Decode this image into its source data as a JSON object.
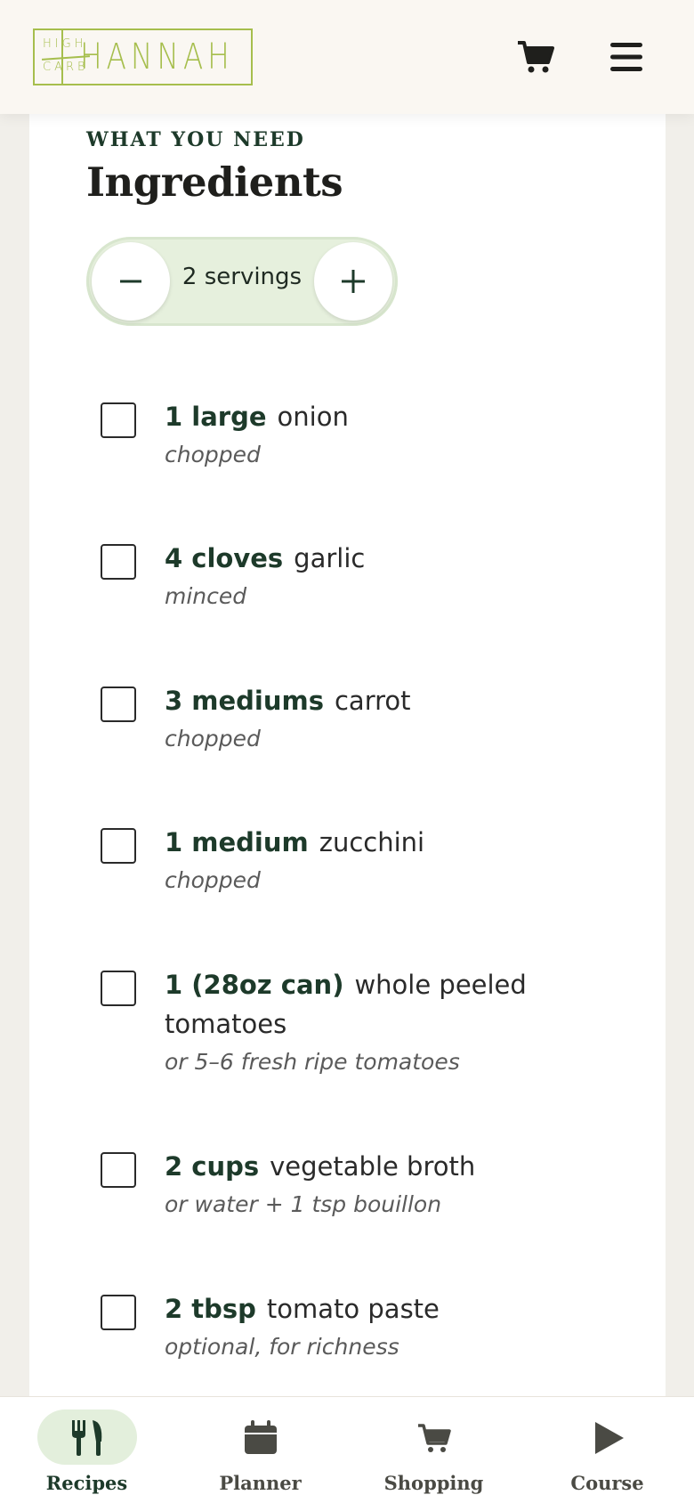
{
  "header": {
    "logo": {
      "top": "HIGH",
      "bottom": "CARB",
      "name": "HANNAH"
    },
    "cart_icon": "cart-icon",
    "menu_icon": "hamburger-menu-icon"
  },
  "section": {
    "eyebrow": "WHAT YOU NEED",
    "title": "Ingredients"
  },
  "servings": {
    "label": "2 servings",
    "value": 2
  },
  "ingredients": [
    {
      "qty": "1 large",
      "name": "onion",
      "note": "chopped"
    },
    {
      "qty": "4 cloves",
      "name": "garlic",
      "note": "minced"
    },
    {
      "qty": "3 mediums",
      "name": "carrot",
      "note": "chopped"
    },
    {
      "qty": "1 medium",
      "name": "zucchini",
      "note": "chopped"
    },
    {
      "qty": "1 (28oz can)",
      "name": "whole peeled tomatoes",
      "note": "or 5–6 fresh ripe tomatoes"
    },
    {
      "qty": "2 cups",
      "name": "vegetable broth",
      "note": "or water + 1 tsp bouillon"
    },
    {
      "qty": "2 tbsp",
      "name": "tomato paste",
      "note": "optional, for richness"
    }
  ],
  "nav": {
    "items": [
      {
        "label": "Recipes",
        "icon": "fork-knife-icon",
        "active": true
      },
      {
        "label": "Planner",
        "icon": "calendar-icon",
        "active": false
      },
      {
        "label": "Shopping",
        "icon": "cart-icon",
        "active": false
      },
      {
        "label": "Course",
        "icon": "play-icon",
        "active": false
      }
    ]
  },
  "colors": {
    "brand_green": "#a6be4d",
    "dark_green": "#1d3a2a",
    "pill_green": "#e3efdc"
  }
}
